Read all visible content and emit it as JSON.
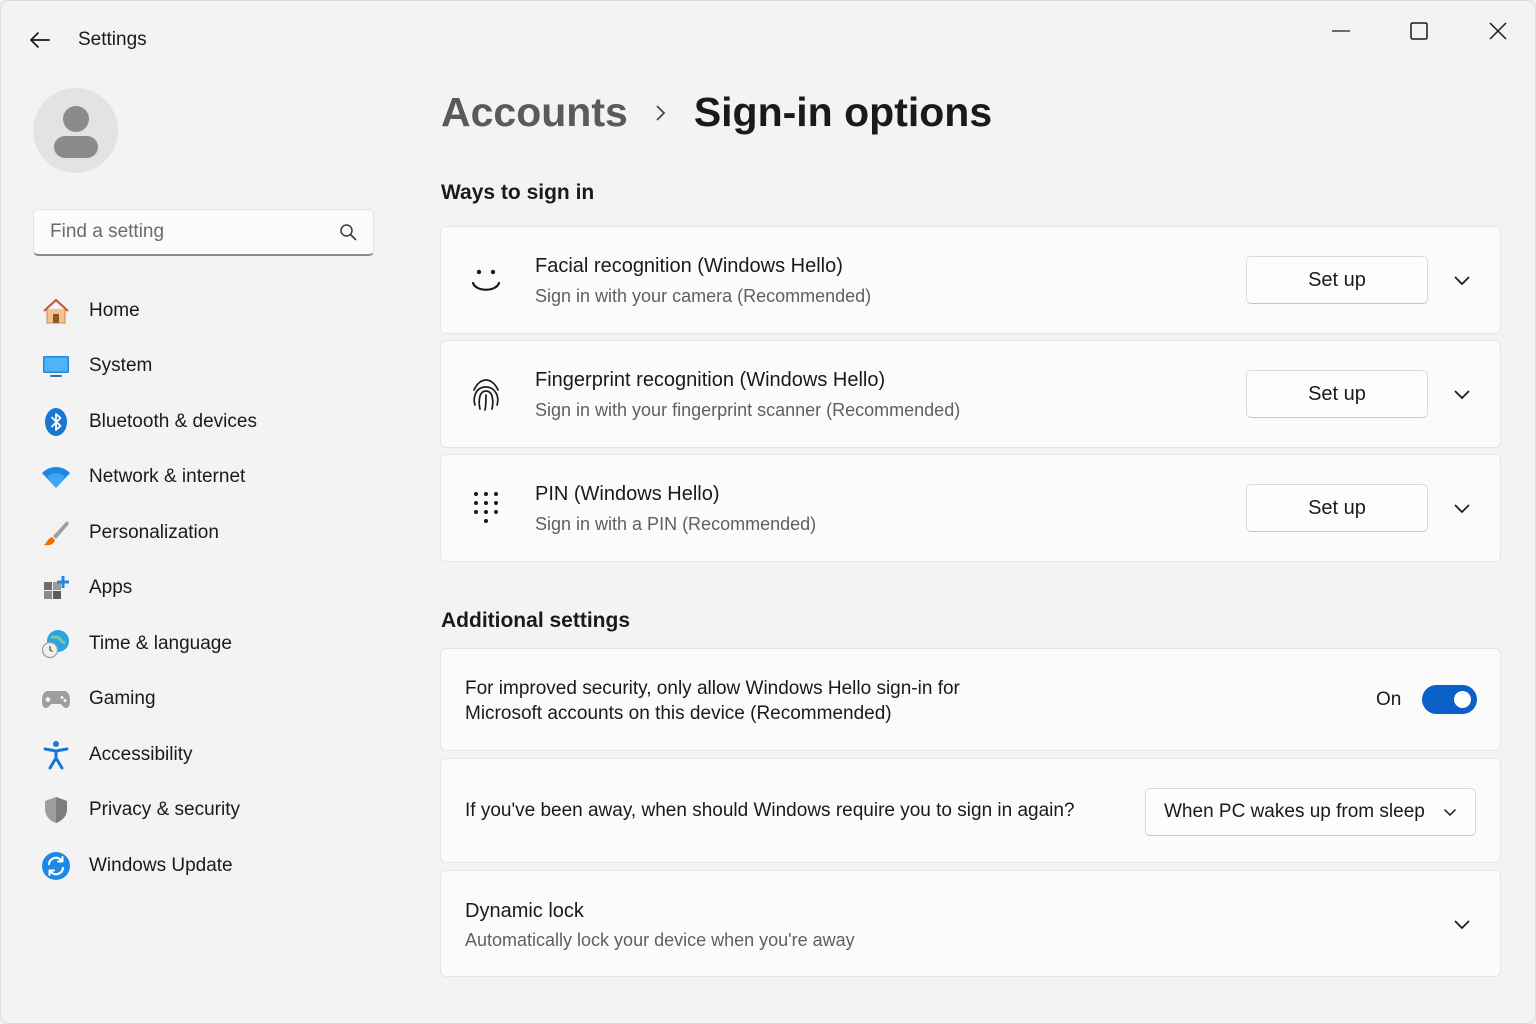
{
  "titlebar": {
    "title": "Settings",
    "icons": {
      "back": "back-arrow-icon",
      "minimize": "minimize-icon",
      "maximize": "maximize-icon",
      "close": "close-icon"
    }
  },
  "search": {
    "placeholder": "Find a setting",
    "value": "",
    "icon": "search-icon"
  },
  "sidebar": {
    "items": [
      {
        "label": "Home",
        "icon": "home-icon"
      },
      {
        "label": "System",
        "icon": "system-icon"
      },
      {
        "label": "Bluetooth & devices",
        "icon": "bluetooth-icon"
      },
      {
        "label": "Network & internet",
        "icon": "wifi-icon"
      },
      {
        "label": "Personalization",
        "icon": "brush-icon"
      },
      {
        "label": "Apps",
        "icon": "apps-icon"
      },
      {
        "label": "Time & language",
        "icon": "globe-clock-icon"
      },
      {
        "label": "Gaming",
        "icon": "gamepad-icon"
      },
      {
        "label": "Accessibility",
        "icon": "accessibility-icon"
      },
      {
        "label": "Privacy & security",
        "icon": "shield-icon"
      },
      {
        "label": "Windows Update",
        "icon": "update-icon"
      }
    ]
  },
  "breadcrumb": {
    "parent": "Accounts",
    "current": "Sign-in options"
  },
  "ways": {
    "heading": "Ways to sign in",
    "items": [
      {
        "title": "Facial recognition (Windows Hello)",
        "subtitle": "Sign in with your camera (Recommended)",
        "button": "Set up",
        "icon": "face-icon"
      },
      {
        "title": "Fingerprint recognition (Windows Hello)",
        "subtitle": "Sign in with your fingerprint scanner (Recommended)",
        "button": "Set up",
        "icon": "fingerprint-icon"
      },
      {
        "title": "PIN (Windows Hello)",
        "subtitle": "Sign in with a PIN (Recommended)",
        "button": "Set up",
        "icon": "pin-keypad-icon"
      }
    ]
  },
  "additional": {
    "heading": "Additional settings",
    "hello_only": {
      "line1": "For improved security, only allow Windows Hello sign-in for",
      "line2": "Microsoft accounts on this device (Recommended)",
      "state_label": "On",
      "enabled": true
    },
    "require_signin": {
      "text": "If you've been away, when should Windows require you to sign in again?",
      "selected": "When PC wakes up from sleep"
    },
    "dynamic_lock": {
      "title": "Dynamic lock",
      "subtitle": "Automatically lock your device when you're away"
    }
  },
  "colors": {
    "accent": "#0a5fc8",
    "background": "#f3f3f3",
    "card": "#fbfbfb"
  }
}
